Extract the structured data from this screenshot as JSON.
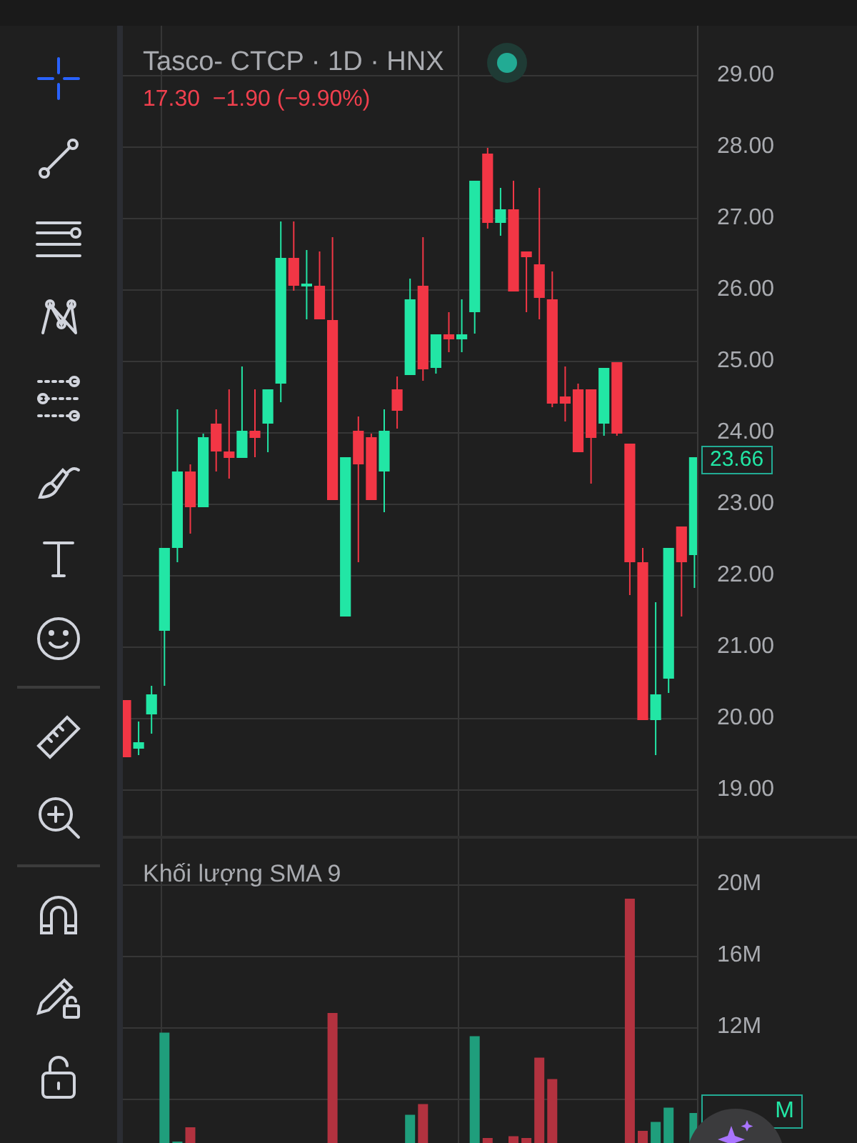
{
  "header": {
    "title": "Tasco- CTCP · 1D · HNX",
    "quote": "17.30  −1.90 (−9.90%)"
  },
  "toolbar": {
    "groups": [
      [
        {
          "kind": "crosshair",
          "selected": true
        },
        {
          "kind": "trend-line",
          "selected": false
        },
        {
          "kind": "parallel-lines",
          "selected": false
        },
        {
          "kind": "pattern",
          "selected": false
        },
        {
          "kind": "fibonacci",
          "selected": false
        },
        {
          "kind": "brush",
          "selected": false
        },
        {
          "kind": "text",
          "selected": false
        },
        {
          "kind": "emoji",
          "selected": false
        }
      ],
      [
        {
          "kind": "ruler",
          "selected": false
        },
        {
          "kind": "zoom",
          "selected": false
        }
      ],
      [
        {
          "kind": "magnet",
          "selected": false
        },
        {
          "kind": "pencil-lock",
          "selected": false
        },
        {
          "kind": "lock",
          "selected": false
        }
      ]
    ]
  },
  "price_pane": {
    "last_price": "23.66",
    "chart_data": {
      "type": "candlestick",
      "grid": true,
      "ylim": [
        18.36,
        29.7
      ],
      "yticks": [
        {
          "value": 29,
          "label": "29.00"
        },
        {
          "value": 28,
          "label": "28.00"
        },
        {
          "value": 27,
          "label": "27.00"
        },
        {
          "value": 26,
          "label": "26.00"
        },
        {
          "value": 25,
          "label": "25.00"
        },
        {
          "value": 24,
          "label": "24.00"
        },
        {
          "value": 23,
          "label": "23.00"
        },
        {
          "value": 22,
          "label": "22.00"
        },
        {
          "value": 21,
          "label": "21.00"
        },
        {
          "value": 20,
          "label": "20.00"
        },
        {
          "value": 19,
          "label": "19.00"
        }
      ],
      "ohlc": [
        [
          20.26,
          20.26,
          19.46,
          19.46
        ],
        [
          19.58,
          19.96,
          19.49,
          19.67
        ],
        [
          20.06,
          20.46,
          19.79,
          20.34
        ],
        [
          21.23,
          22.39,
          20.46,
          22.39
        ],
        [
          22.39,
          24.33,
          22.19,
          23.46
        ],
        [
          23.46,
          23.56,
          22.59,
          22.96
        ],
        [
          22.96,
          23.99,
          22.96,
          23.94
        ],
        [
          24.13,
          24.33,
          23.46,
          23.74
        ],
        [
          23.74,
          24.61,
          23.36,
          23.65
        ],
        [
          23.65,
          24.93,
          23.65,
          24.03
        ],
        [
          24.03,
          24.61,
          23.66,
          23.93
        ],
        [
          24.13,
          24.61,
          23.73,
          24.61
        ],
        [
          24.69,
          26.96,
          24.43,
          26.45
        ],
        [
          26.45,
          26.96,
          25.99,
          26.06
        ],
        [
          26.05,
          26.56,
          25.59,
          26.09
        ],
        [
          26.06,
          26.54,
          25.59,
          25.59
        ],
        [
          25.58,
          26.74,
          23.06,
          23.06
        ],
        [
          21.43,
          23.66,
          21.43,
          23.66
        ],
        [
          24.03,
          24.23,
          22.19,
          23.56
        ],
        [
          23.94,
          23.99,
          23.06,
          23.06
        ],
        [
          23.46,
          24.33,
          22.89,
          24.03
        ],
        [
          24.61,
          24.79,
          24.06,
          24.31
        ],
        [
          24.81,
          26.16,
          24.81,
          25.87
        ],
        [
          26.06,
          26.74,
          24.73,
          24.89
        ],
        [
          24.91,
          25.38,
          24.83,
          25.38
        ],
        [
          25.38,
          25.69,
          25.13,
          25.31
        ],
        [
          25.31,
          25.87,
          25.13,
          25.38
        ],
        [
          25.69,
          27.53,
          25.39,
          27.53
        ],
        [
          27.91,
          27.99,
          26.86,
          26.94
        ],
        [
          26.94,
          27.43,
          26.76,
          27.13
        ],
        [
          27.13,
          27.53,
          25.98,
          25.98
        ],
        [
          26.54,
          26.54,
          25.69,
          26.46
        ],
        [
          26.36,
          27.43,
          25.59,
          25.89
        ],
        [
          25.87,
          26.26,
          24.36,
          24.41
        ],
        [
          24.51,
          24.93,
          24.16,
          24.41
        ],
        [
          24.61,
          24.69,
          23.73,
          23.73
        ],
        [
          24.61,
          24.61,
          23.29,
          23.93
        ],
        [
          24.13,
          24.91,
          23.96,
          24.91
        ],
        [
          24.99,
          24.99,
          23.96,
          23.99
        ],
        [
          23.85,
          23.85,
          21.73,
          22.19
        ],
        [
          22.19,
          22.39,
          19.98,
          19.98
        ],
        [
          19.98,
          21.63,
          19.49,
          20.34
        ],
        [
          20.56,
          22.39,
          20.36,
          22.39
        ],
        [
          22.69,
          22.69,
          21.43,
          22.19
        ],
        [
          22.29,
          23.66,
          21.83,
          23.66
        ]
      ]
    }
  },
  "volume_pane": {
    "title": "Khối lượng SMA 9",
    "last_volume": "M",
    "chart_data": {
      "type": "bar",
      "grid": true,
      "ylim": [
        5.52,
        22.56
      ],
      "yticks": [
        {
          "value": 20,
          "label": "20M"
        },
        {
          "value": 16,
          "label": "16M"
        },
        {
          "value": 12,
          "label": "12M"
        }
      ],
      "series": [
        {
          "color": "#1f9e7c",
          "values": [
            null,
            null,
            null,
            11.7,
            5.6,
            null,
            null,
            null,
            null,
            null,
            null,
            null,
            null,
            null,
            null,
            null,
            null,
            null,
            null,
            null,
            null,
            null,
            7.1,
            null,
            null,
            null,
            null,
            11.5,
            null,
            null,
            null,
            null,
            null,
            null,
            null,
            null,
            null,
            null,
            null,
            null,
            null,
            6.7,
            7.5,
            null,
            7.2
          ]
        },
        {
          "color": "#b2323f",
          "values": [
            null,
            null,
            null,
            null,
            null,
            6.4,
            null,
            null,
            null,
            null,
            null,
            null,
            null,
            null,
            null,
            null,
            12.8,
            null,
            null,
            null,
            null,
            null,
            null,
            7.7,
            null,
            null,
            null,
            null,
            5.8,
            null,
            5.9,
            5.8,
            10.3,
            9.1,
            null,
            null,
            null,
            null,
            null,
            19.2,
            6.2,
            null,
            null,
            null,
            null
          ]
        }
      ]
    }
  }
}
